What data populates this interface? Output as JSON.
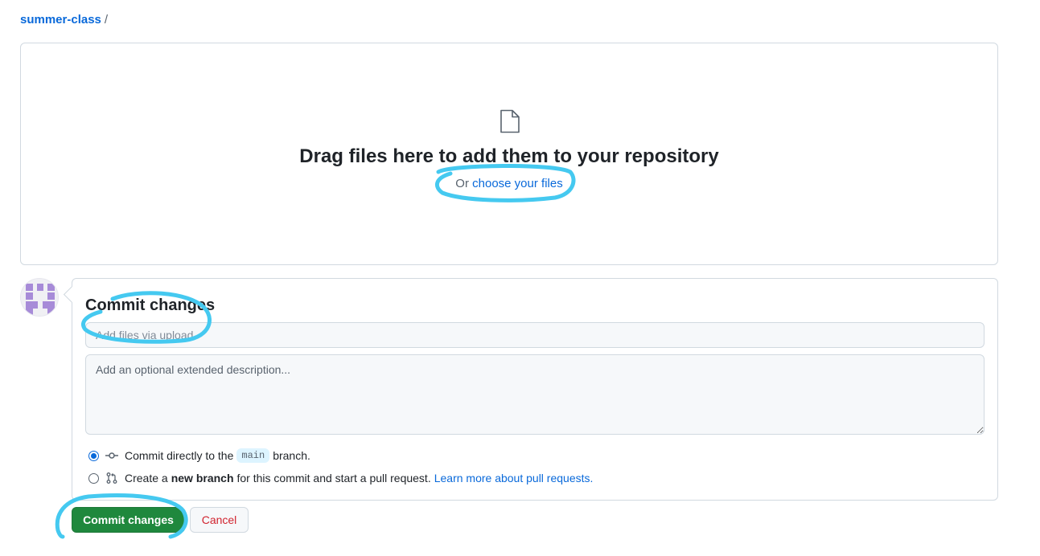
{
  "breadcrumb": {
    "repo": "summer-class",
    "separator": "/"
  },
  "dropzone": {
    "icon": "file-icon",
    "title": "Drag files here to add them to your repository",
    "subtitle_prefix": "Or",
    "choose_link": "choose your files"
  },
  "commit": {
    "title": "Commit changes",
    "summary_placeholder": "Add files via upload",
    "description_placeholder": "Add an optional extended description...",
    "options": [
      {
        "text_before": "Commit directly to the",
        "branch": "main",
        "text_after": "branch.",
        "checked": true,
        "icon": "git-commit-icon"
      },
      {
        "text_before": "Create a",
        "bold": "new branch",
        "text_after": "for this commit and start a pull request.",
        "link": "Learn more about pull requests.",
        "checked": false,
        "icon": "git-pull-request-icon"
      }
    ],
    "commit_button": "Commit changes",
    "cancel_button": "Cancel"
  },
  "colors": {
    "link": "#0969da",
    "primary_button": "#1f883d",
    "cancel_text": "#d1242f",
    "annotation": "#45c9f0"
  }
}
